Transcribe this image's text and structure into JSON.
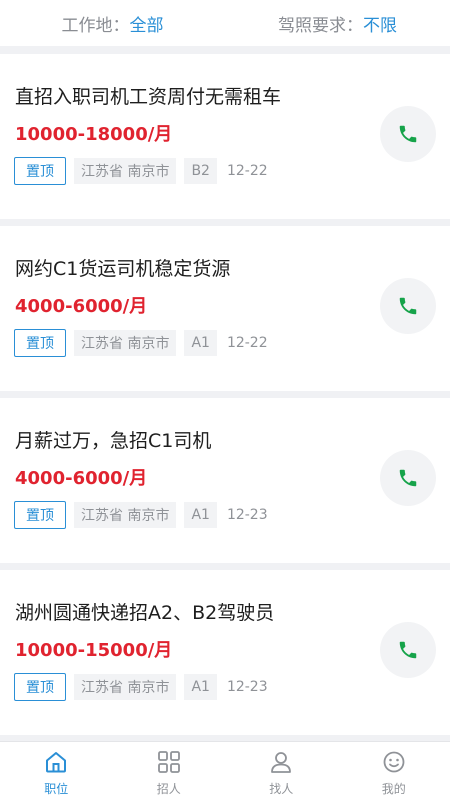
{
  "filters": {
    "location_label": "工作地：",
    "location_value": "全部",
    "license_label": "驾照要求：",
    "license_value": "不限"
  },
  "jobs": [
    {
      "title": "直招入职司机工资周付无需租车",
      "salary": "10000-18000/月",
      "pin": "置顶",
      "province": "江苏省",
      "city": "南京市",
      "license": "B2",
      "date": "12-22",
      "call_icon": "phone-icon"
    },
    {
      "title": "网约C1货运司机稳定货源",
      "salary": "4000-6000/月",
      "pin": "置顶",
      "province": "江苏省",
      "city": "南京市",
      "license": "A1",
      "date": "12-22",
      "call_icon": "phone-icon"
    },
    {
      "title": "月薪过万，急招C1司机",
      "salary": "4000-6000/月",
      "pin": "置顶",
      "province": "江苏省",
      "city": "南京市",
      "license": "A1",
      "date": "12-23",
      "call_icon": "phone-icon"
    },
    {
      "title": "湖州圆通快递招A2、B2驾驶员",
      "salary": "10000-15000/月",
      "pin": "置顶",
      "province": "江苏省",
      "city": "南京市",
      "license": "A1",
      "date": "12-23",
      "call_icon": "phone-icon"
    }
  ],
  "tabs": [
    {
      "label": "职位",
      "icon": "home-icon",
      "active": true
    },
    {
      "label": "招人",
      "icon": "grid-icon",
      "active": false
    },
    {
      "label": "找人",
      "icon": "person-icon",
      "active": false
    },
    {
      "label": "我的",
      "icon": "smiley-icon",
      "active": false
    }
  ],
  "colors": {
    "accent": "#2a8fd6",
    "salary": "#e0232f",
    "phone": "#16a34a",
    "muted": "#8f9297"
  }
}
